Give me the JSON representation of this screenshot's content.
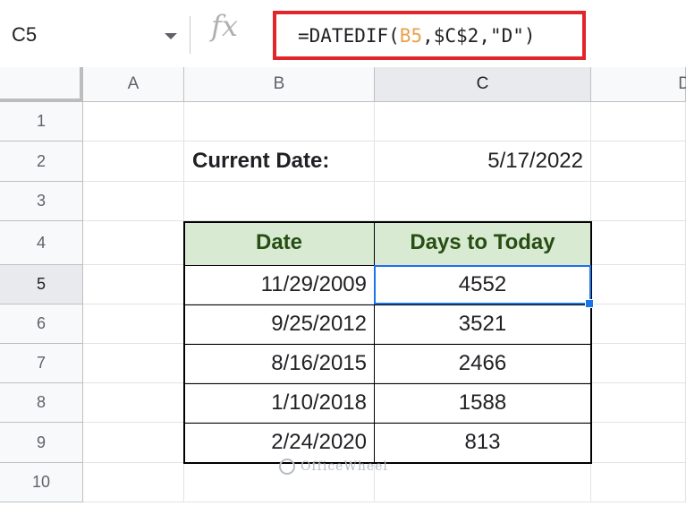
{
  "name_box": {
    "value": "C5"
  },
  "fx_label": "fx",
  "formula": {
    "prefix": "=DATEDIF(",
    "ref1": "B5",
    "sep1": ",",
    "ref2": "$C$2",
    "suffix": ",\"D\")"
  },
  "columns": [
    "A",
    "B",
    "C",
    "D"
  ],
  "rows": [
    "1",
    "2",
    "3",
    "4",
    "5",
    "6",
    "7",
    "8",
    "9",
    "10"
  ],
  "cells": {
    "B2": "Current Date:",
    "C2": "5/17/2022",
    "B4": "Date",
    "C4": "Days to Today",
    "B5": "11/29/2009",
    "C5": "4552",
    "B6": "9/25/2012",
    "C6": "3521",
    "B7": "8/16/2015",
    "C7": "2466",
    "B8": "1/10/2018",
    "C8": "1588",
    "B9": "2/24/2020",
    "C9": "813"
  },
  "watermark": "OfficeWheel",
  "colors": {
    "header_fill": "#d9ead3",
    "header_text": "#274e13",
    "selection": "#1a73e8",
    "highlight_box": "#e2242b"
  }
}
